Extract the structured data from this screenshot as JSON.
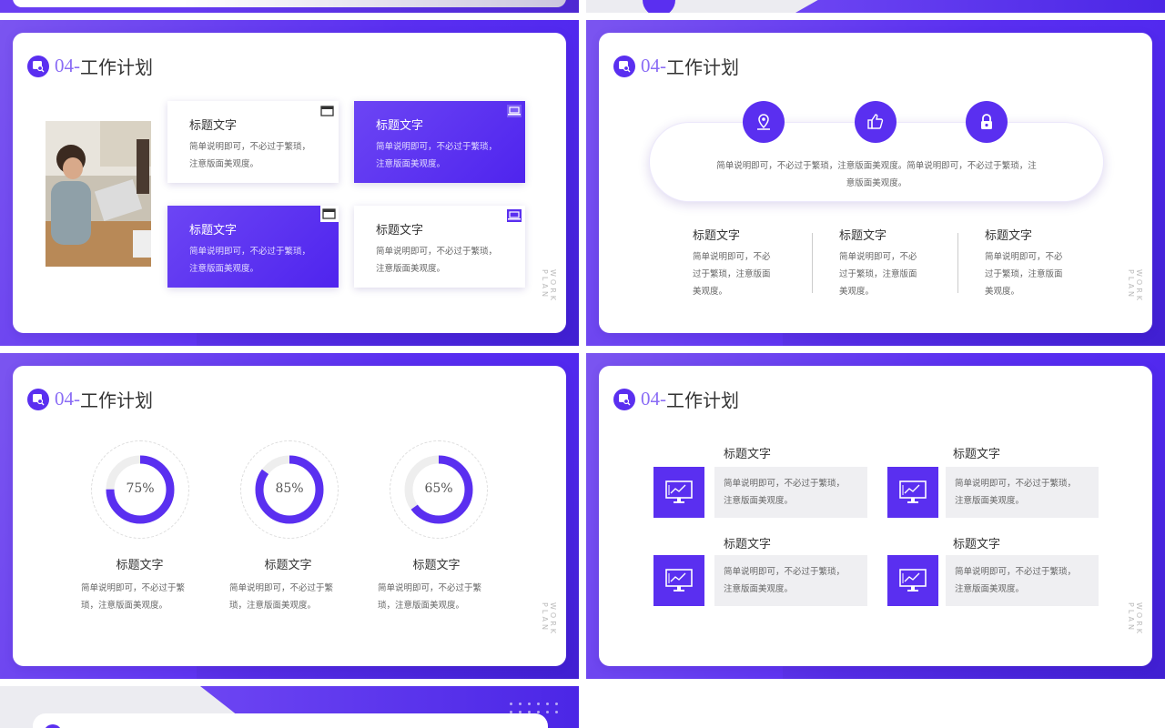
{
  "colors": {
    "accent": "#5a2ff0",
    "accent_light": "#8a6cf5",
    "gray_box": "#efeff2"
  },
  "common": {
    "title_num": "04-",
    "title_text": "工作计划",
    "vertical_text": "WORK PLAN",
    "heading": "标题文字"
  },
  "slide1": {
    "boxes": [
      {
        "heading": "标题文字",
        "lines": [
          "简单说明即可，不必过于繁琐，",
          "注意版面美观度。"
        ],
        "icon": "window-icon"
      },
      {
        "heading": "标题文字",
        "lines": [
          "简单说明即可，不必过于繁琐，",
          "注意版面美观度。"
        ],
        "icon": "laptop-icon"
      },
      {
        "heading": "标题文字",
        "lines": [
          "简单说明即可，不必过于繁琐，",
          "注意版面美观度。"
        ],
        "icon": "window-icon"
      },
      {
        "heading": "标题文字",
        "lines": [
          "简单说明即可，不必过于繁琐，",
          "注意版面美观度。"
        ],
        "icon": "laptop-icon"
      }
    ]
  },
  "slide2": {
    "pill_lines": [
      "简单说明即可，不必过于繁琐，注意版面美观度。简单说明即可，不必过于繁琐，注",
      "意版面美观度。"
    ],
    "icons": [
      "location-pin-icon",
      "thumbs-up-icon",
      "lock-icon"
    ],
    "cols": [
      {
        "heading": "标题文字",
        "lines": [
          "简单说明即可，不必",
          "过于繁琐，注意版面",
          "美观度。"
        ]
      },
      {
        "heading": "标题文字",
        "lines": [
          "简单说明即可，不必",
          "过于繁琐，注意版面",
          "美观度。"
        ]
      },
      {
        "heading": "标题文字",
        "lines": [
          "简单说明即可，不必",
          "过于繁琐，注意版面",
          "美观度。"
        ]
      }
    ]
  },
  "slide3": {
    "rings": [
      {
        "label": "75%",
        "value": 75,
        "heading": "标题文字",
        "lines": [
          "简单说明即可，不必过于繁",
          "琐，注意版面美观度。"
        ]
      },
      {
        "label": "85%",
        "value": 85,
        "heading": "标题文字",
        "lines": [
          "简单说明即可，不必过于繁",
          "琐，注意版面美观度。"
        ]
      },
      {
        "label": "65%",
        "value": 65,
        "heading": "标题文字",
        "lines": [
          "简单说明即可，不必过于繁",
          "琐，注意版面美观度。"
        ]
      }
    ]
  },
  "slide4": {
    "items": [
      {
        "heading": "标题文字",
        "lines": [
          "简单说明即可，不必过于繁琐，",
          "注意版面美观度。"
        ],
        "icon": "monitor-chart-icon"
      },
      {
        "heading": "标题文字",
        "lines": [
          "简单说明即可，不必过于繁琐，",
          "注意版面美观度。"
        ],
        "icon": "monitor-chart-icon"
      },
      {
        "heading": "标题文字",
        "lines": [
          "简单说明即可，不必过于繁琐，",
          "注意版面美观度。"
        ],
        "icon": "monitor-chart-icon"
      },
      {
        "heading": "标题文字",
        "lines": [
          "简单说明即可，不必过于繁琐，",
          "注意版面美观度。"
        ],
        "icon": "monitor-chart-icon"
      }
    ]
  }
}
